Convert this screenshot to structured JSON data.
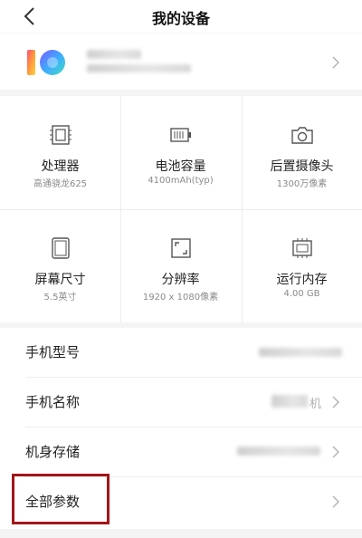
{
  "header": {
    "title": "我的设备",
    "back_icon": "chevron-left-icon"
  },
  "device": {
    "logo_text": "10"
  },
  "specs": [
    {
      "icon": "chip-icon",
      "title": "处理器",
      "value": "高通骁龙625"
    },
    {
      "icon": "battery-icon",
      "title": "电池容量",
      "value": "4100mAh(typ)"
    },
    {
      "icon": "camera-icon",
      "title": "后置摄像头",
      "value": "1300万像素"
    },
    {
      "icon": "screen-icon",
      "title": "屏幕尺寸",
      "value": "5.5英寸"
    },
    {
      "icon": "resolution-icon",
      "title": "分辨率",
      "value": "1920 x 1080像素"
    },
    {
      "icon": "memory-icon",
      "title": "运行内存",
      "value": "4.00 GB"
    }
  ],
  "list": [
    {
      "label": "手机型号"
    },
    {
      "label": "手机名称",
      "value_suffix": "机"
    },
    {
      "label": "机身存储"
    },
    {
      "label": "全部参数"
    }
  ],
  "colors": {
    "highlight": "#a3161a",
    "background": "#f4f4f4"
  }
}
